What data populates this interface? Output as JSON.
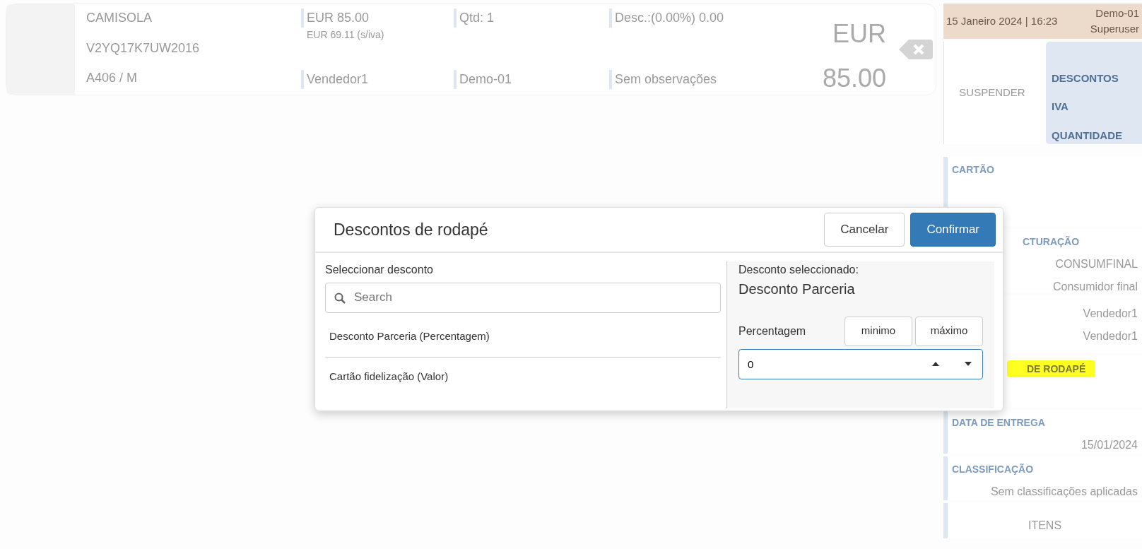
{
  "product": {
    "name": "CAMISOLA",
    "code": "V2YQ17K7UW2016",
    "variant": "A406 / M",
    "price": "EUR 85.00",
    "price_net": "EUR 69.11 (s/iva)",
    "quantity": "Qtd: 1",
    "discount": "Desc.:(0.00%) 0.00",
    "seller": "Vendedor1",
    "store": "Demo-01",
    "notes": "Sem observações",
    "total_currency": "EUR",
    "total_amount": "85.00"
  },
  "session": {
    "datetime": "15 Janeiro 2024 | 16:23",
    "store": "Demo-01",
    "user": "Superuser"
  },
  "actions": {
    "suspend": "SUSPENDER",
    "menu": [
      "DESCONTOS",
      "IVA",
      "QUANTIDADE"
    ]
  },
  "sections": [
    {
      "title": "CARTÃO"
    },
    {
      "title": "CTURAÇÃO",
      "lines": [
        "CONSUMFINAL",
        "Consumidor final"
      ]
    },
    {
      "lines": [
        "Vendedor1",
        "Vendedor1"
      ]
    },
    {
      "title": "DE RODAPÉ",
      "highlighted": true
    },
    {
      "title": "DATA DE ENTREGA",
      "lines": [
        "15/01/2024"
      ]
    },
    {
      "title": "CLASSIFICAÇÃO",
      "lines": [
        "Sem classificações aplicadas"
      ]
    },
    {
      "lines": [
        "ITENS"
      ],
      "centered": true
    }
  ],
  "modal": {
    "title": "Descontos de rodapé",
    "buttons": [
      {
        "label": "Cancelar",
        "kind": "secondary"
      },
      {
        "label": "Confirmar",
        "kind": "primary"
      }
    ],
    "list_label": "Seleccionar desconto",
    "search": {
      "placeholder": "Search"
    },
    "discounts": [
      "Desconto Parceria (Percentagem)",
      "Cartão fidelização (Valor)"
    ],
    "selected_label": "Desconto seleccionado:",
    "selected_name": "Desconto Parceria",
    "field_label": "Percentagem",
    "limit_buttons": [
      "minimo",
      "máximo"
    ],
    "value": "0"
  }
}
